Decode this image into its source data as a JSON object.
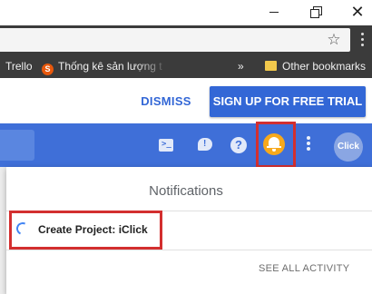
{
  "window": {
    "close_glyph": "✕"
  },
  "toolbar": {
    "star_icon": "star-icon",
    "star_glyph": "☆"
  },
  "bookmarks": {
    "items": [
      {
        "label": "Trello"
      },
      {
        "label": "Thống kê sản lượng t",
        "icon": "s-logo",
        "icon_glyph": "S"
      }
    ],
    "overflow_glyph": "»",
    "other_label": "Other bookmarks"
  },
  "promo": {
    "dismiss_label": "DISMISS",
    "signup_label": "SIGN UP FOR FREE TRIAL",
    "accent_color": "#3367d6"
  },
  "appbar": {
    "background_color": "#3f6fd8",
    "icons": [
      "cloud-shell-icon",
      "feedback-icon",
      "help-icon",
      "notifications-bell-icon",
      "more-vert-icon"
    ],
    "shell_glyph": ">_",
    "feedback_glyph": "!",
    "help_glyph": "?",
    "bell_color": "#f7a91c",
    "avatar_text": "Click"
  },
  "notifications": {
    "title": "Notifications",
    "tasks": [
      {
        "label": "Create Project: iClick",
        "status": "in-progress"
      }
    ],
    "see_all_label": "SEE ALL ACTIVITY"
  },
  "highlight_color": "#d32f2f"
}
